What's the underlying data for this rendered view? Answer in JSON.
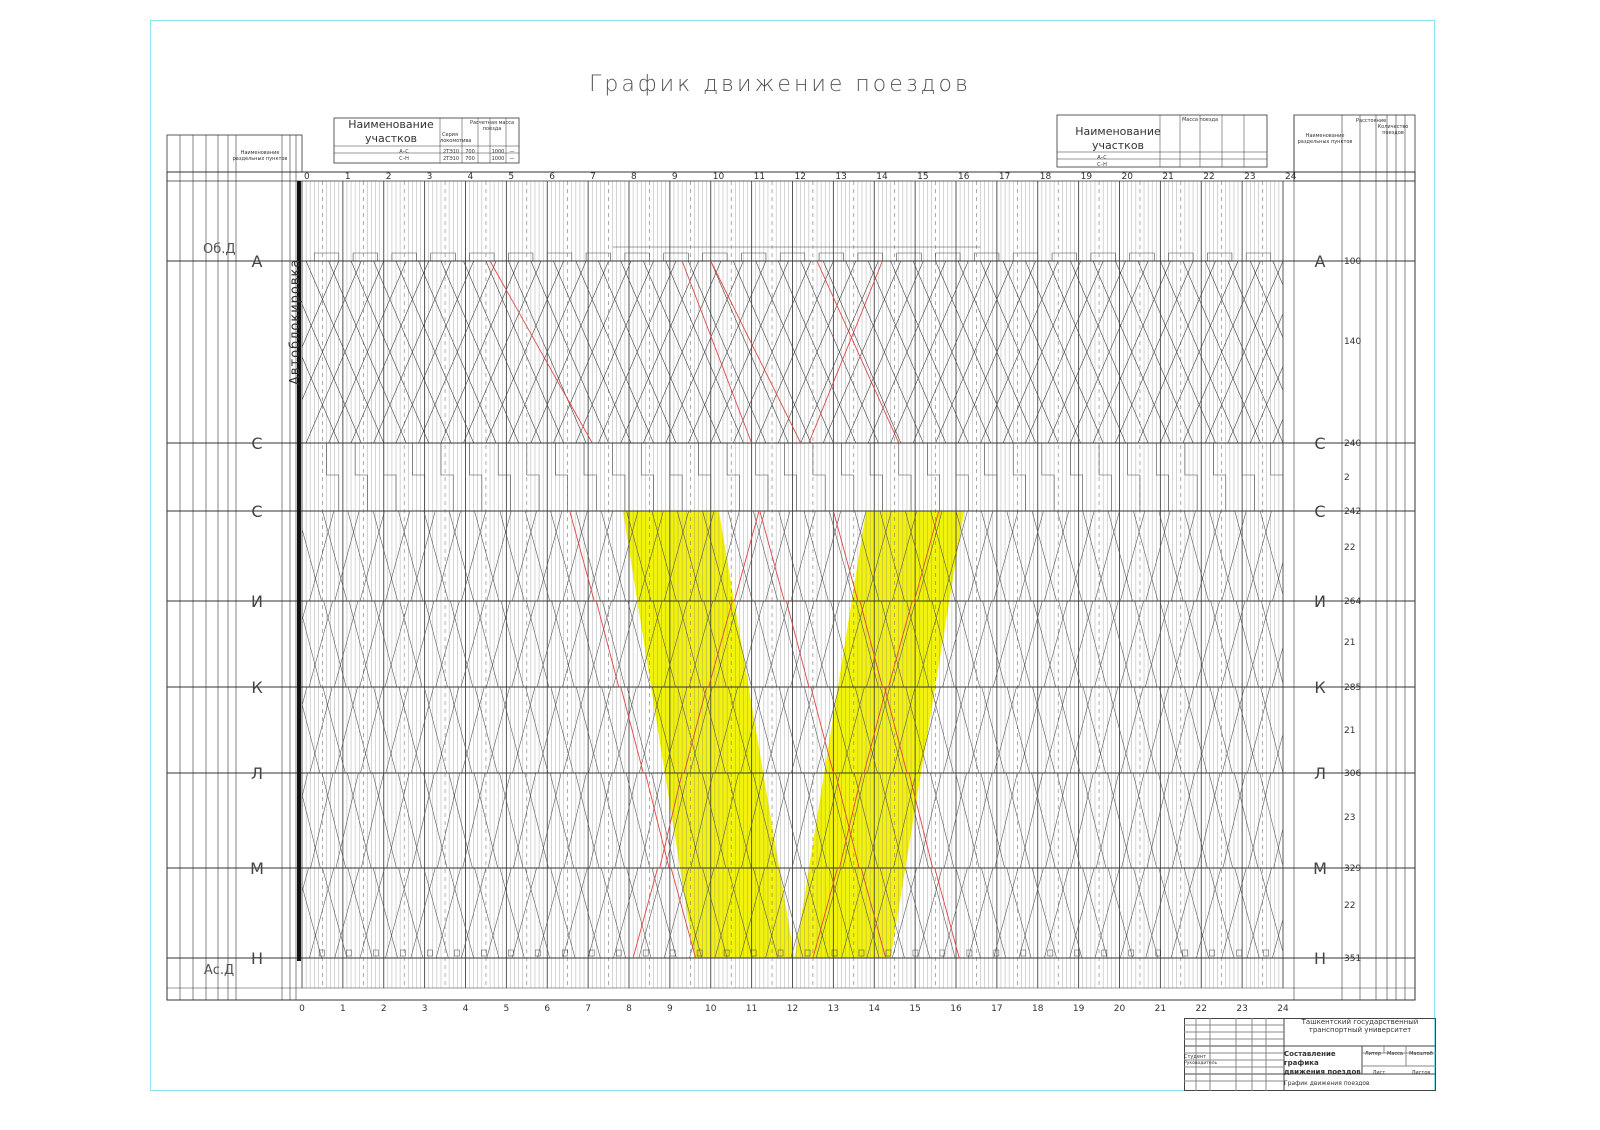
{
  "title": "График движение поездов",
  "stations": [
    {
      "name": "А",
      "km": "100"
    },
    {
      "name": "С",
      "km": "240"
    },
    {
      "name": "С",
      "km": "242"
    },
    {
      "name": "И",
      "km": "264"
    },
    {
      "name": "К",
      "km": "285"
    },
    {
      "name": "Л",
      "km": "306"
    },
    {
      "name": "М",
      "km": "329"
    },
    {
      "name": "Н",
      "km": "351"
    }
  ],
  "top_labels": {
    "ob_d": "Об.Д",
    "as_d": "Ас.Д",
    "autoblock": "Автоблокировка"
  },
  "hours": [
    "0",
    "1",
    "2",
    "3",
    "4",
    "5",
    "6",
    "7",
    "8",
    "9",
    "10",
    "11",
    "12",
    "13",
    "14",
    "15",
    "16",
    "17",
    "18",
    "19",
    "20",
    "21",
    "22",
    "23",
    "24"
  ],
  "right_intervals": {
    "a_c_mid": "140",
    "c_c": "2",
    "c_i": "22",
    "i_k": "21",
    "k_l": "21",
    "l_m": "23",
    "m_n": "22"
  },
  "left_header": {
    "station_name_title": "Наименование раздельных пунктов"
  },
  "section_table_left": {
    "header": "Наименование участков",
    "col_series": "Серия локомотива",
    "col_weight": "Расчетная масса поезда",
    "rows": [
      {
        "section": "А–С",
        "series": "2ТЭ10",
        "w1": "700",
        "w2": "1000",
        "w3": "—"
      },
      {
        "section": "С–Н",
        "series": "2ТЭ10",
        "w1": "700",
        "w2": "1000",
        "w3": "—"
      }
    ]
  },
  "section_table_right": {
    "header": "Наименование участков",
    "col_mass": "Масса поезда",
    "rows": [
      {
        "section": "А–С"
      },
      {
        "section": "С–Н"
      }
    ]
  },
  "right_header": {
    "station_name_title": "Наименование раздельных пунктов",
    "col_distance": "Расстояние",
    "col_count": "Количество поездов"
  },
  "stamp": {
    "org_line1": "Ташкентский государственный",
    "org_line2": "транспортный университет",
    "work_title_1": "Составление графика",
    "work_title_2": "движения поездов",
    "sheet_name": "График движения поездов",
    "col_lit": "Литер",
    "col_mass": "Масса",
    "col_scale": "Масштаб",
    "sheet": "Лист",
    "sheets": "Листов",
    "student_label": "Студент",
    "checker_label": "Руководитель"
  },
  "colors": {
    "ink": "#333333",
    "red_trains": "#e04848",
    "highlight": "#f2f20c",
    "sheet_border": "#8fe3ea"
  }
}
